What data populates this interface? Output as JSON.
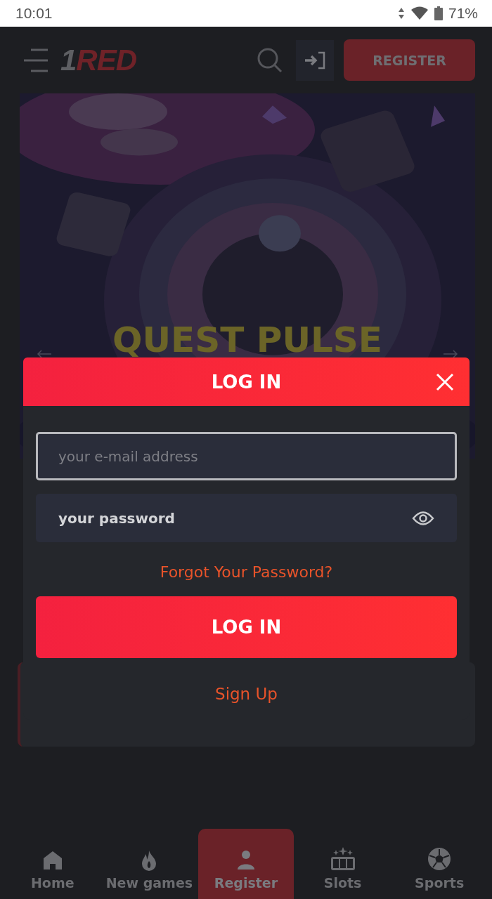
{
  "status_bar": {
    "time": "10:01",
    "battery": "71%"
  },
  "header": {
    "logo_prefix": "1",
    "logo_name": "RED",
    "register": "REGISTER"
  },
  "banner": {
    "kind": "picture",
    "title": "QUEST PULSE"
  },
  "modal": {
    "title": "LOG IN",
    "email_placeholder": "your e-mail address",
    "password_placeholder": "your password",
    "forgot": "Forgot Your Password?",
    "submit": "LOG IN",
    "signup": "Sign Up"
  },
  "nav": [
    {
      "label": "Home",
      "selected": false
    },
    {
      "label": "New games",
      "selected": false
    },
    {
      "label": "Register",
      "selected": true
    },
    {
      "label": "Slots",
      "selected": false
    },
    {
      "label": "Sports",
      "selected": false
    }
  ]
}
